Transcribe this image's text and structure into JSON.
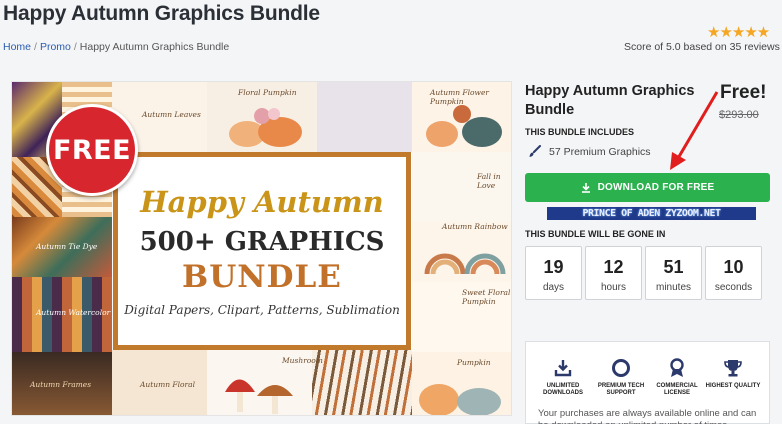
{
  "header": {
    "title": "Happy Autumn Graphics Bundle",
    "breadcrumb": {
      "home": "Home",
      "promo": "Promo",
      "current": "Happy Autumn Graphics Bundle",
      "sep": "/"
    },
    "rating_stars": "★★★★★",
    "rating_value": 5.0,
    "score_text": "Score of 5.0 based on 35 reviews"
  },
  "hero": {
    "badge": "FREE",
    "headline": "Happy Autumn",
    "count_line": "500+ GRAPHICS",
    "bundle_word": "BUNDLE",
    "subline": "Digital Papers, Clipart, Patterns, Sublimation",
    "tile_labels": {
      "leaves": "Autumn Leaves",
      "pumpkin": "Floral Pumpkin",
      "flower_pumpkin": "Autumn Flower Pumpkin",
      "fall_love": "Fall in Love",
      "rainbow": "Autumn Rainbow",
      "sweet_floral": "Sweet Floral Pumpkin",
      "tie_dye": "Autumn Tie Dye",
      "watercolor": "Autumn Watercolor",
      "frames": "Autumn Frames",
      "floral": "Autumn Floral",
      "mushroom": "Mushroom",
      "pumpkin2": "Pumpkin"
    }
  },
  "product": {
    "name": "Happy Autumn Graphics Bundle",
    "price_label": "Free!",
    "old_price": "$293.00",
    "includes_label": "THIS BUNDLE INCLUDES",
    "item_count_text": "57 Premium Graphics",
    "download_label": "DOWNLOAD FOR FREE",
    "watermark_text": "PRINCE OF ADEN ZYZOOM.NET"
  },
  "countdown": {
    "label": "THIS BUNDLE WILL BE GONE IN",
    "days": "19",
    "days_label": "days",
    "hours": "12",
    "hours_label": "hours",
    "minutes": "51",
    "minutes_label": "minutes",
    "seconds": "10",
    "seconds_label": "seconds"
  },
  "features": {
    "items": [
      {
        "label": "UNLIMITED DOWNLOADS",
        "icon": "download-tray-icon"
      },
      {
        "label": "PREMIUM TECH SUPPORT",
        "icon": "lifebuoy-icon"
      },
      {
        "label": "COMMERCIAL LICENSE",
        "icon": "award-ribbon-icon"
      },
      {
        "label": "HIGHEST QUALITY",
        "icon": "trophy-icon"
      }
    ],
    "note": "Your purchases are always available online and can be downloaded an unlimited number of times."
  },
  "colors": {
    "accent_green": "#2bb14e",
    "badge_red": "#d7262e",
    "star_gold": "#f5a623",
    "link_blue": "#2a5db0",
    "icon_navy": "#2c3a6b"
  }
}
